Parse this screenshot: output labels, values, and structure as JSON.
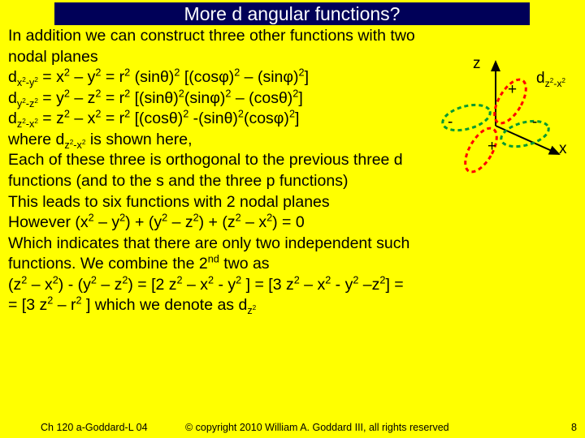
{
  "title": "More d angular functions?",
  "body": {
    "l1": "In addition we can construct three other functions with two",
    "l2": "nodal planes",
    "l3a": "d",
    "l3sub": "x",
    "l3sup2": "2",
    "l3subm": "-y",
    "l3c": " = x",
    "l3d": " – y",
    "l3e": " = r",
    "l3f": " (sinθ)",
    "l3g": " [(cosφ)",
    "l3h": " – (sinφ)",
    "l3i": "]",
    "l4a": "d",
    "l4sub": "y",
    "l4subm": "-z",
    "l4c": " = y",
    "l4d": " – z",
    "l4e": " = r",
    "l4f": " [(sinθ)",
    "l4g": "(sinφ)",
    "l4h": " – (cosθ)",
    "l4i": "]",
    "l5a": "d",
    "l5sub": "z",
    "l5subm": "-x",
    "l5c": " = z",
    "l5d": " – x",
    "l5e": " = r",
    "l5f": " [(cosθ)",
    "l5g": " -(sinθ)",
    "l5h": "(cosφ)",
    "l5i": "]",
    "l6a": "where d",
    "l6sub": "z",
    "l6subm": "-x",
    "l6b": " is shown here,",
    "l7": "Each of these three is orthogonal to the previous three d",
    "l8": "functions (and to the s and the three p functions)",
    "l9": "This leads to six functions with 2 nodal planes",
    "l10": "However (x",
    "l10b": " – y",
    "l10c": ") + (y",
    "l10d": " – z",
    "l10e": ") + (z",
    "l10f": " – x",
    "l10g": ") = 0",
    "l11": "Which indicates that there are only two independent such",
    "l12": "functions. We combine the 2",
    "l12nd": "nd",
    "l12b": " two as",
    "l13": "(z",
    "l13b": " – x",
    "l13c": ") - (y",
    "l13d": " – z",
    "l13e": ") = [2 z",
    "l13f": " – x",
    "l13g": " - y",
    "l13h": " ] = [3 z",
    "l13i": " – x",
    "l13j": " - y",
    "l13k": " –z",
    "l13l": "] =",
    "l14": "= [3 z",
    "l14b": " – r",
    "l14c": " ] which we denote as d",
    "l14sub": "z"
  },
  "sup2": "2",
  "diagram": {
    "z": "z",
    "x": "x",
    "dlabel_a": "d",
    "dlabel_sub": "z",
    "dlabel_subm": "-x",
    "plus": "+",
    "minus": "-"
  },
  "footer": {
    "left": "Ch 120 a-Goddard-L 04",
    "center": "© copyright 2010 William A. Goddard III, all rights reserved",
    "page": "8"
  }
}
